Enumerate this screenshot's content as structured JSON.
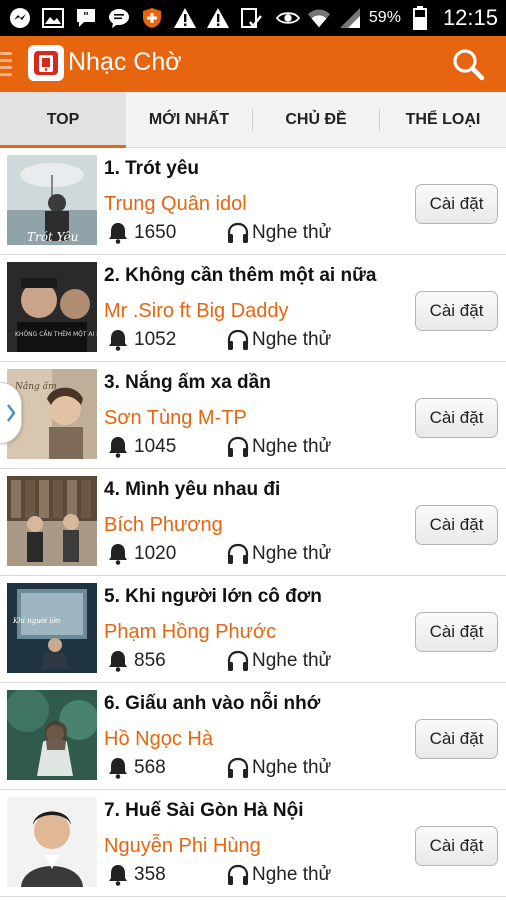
{
  "status_bar": {
    "battery": "59%",
    "time": "12:15"
  },
  "app_bar": {
    "title": "Nhạc Chờ"
  },
  "tabs": [
    {
      "label": "TOP",
      "active": true
    },
    {
      "label": "MỚI NHẤT",
      "active": false
    },
    {
      "label": "CHỦ ĐỀ",
      "active": false
    },
    {
      "label": "THỂ LOẠI",
      "active": false
    }
  ],
  "songs": [
    {
      "title": "1. Trót yêu",
      "artist": "Trung Quân idol",
      "count": "1650",
      "listen_label": "Nghe thử",
      "install_label": "Cài đặt"
    },
    {
      "title": "2. Không cần thêm một ai nữa",
      "artist": "Mr .Siro ft Big Daddy",
      "count": "1052",
      "listen_label": "Nghe thử",
      "install_label": "Cài đặt"
    },
    {
      "title": "3. Nắng ấm xa dần",
      "artist": "Sơn Tùng M-TP",
      "count": "1045",
      "listen_label": "Nghe thử",
      "install_label": "Cài đặt"
    },
    {
      "title": "4. Mình yêu nhau đi",
      "artist": "Bích Phương",
      "count": "1020",
      "listen_label": "Nghe thử",
      "install_label": "Cài đặt"
    },
    {
      "title": "5. Khi người lớn cô đơn",
      "artist": "Phạm Hồng Phước",
      "count": "856",
      "listen_label": "Nghe thử",
      "install_label": "Cài đặt"
    },
    {
      "title": "6. Giấu anh vào nỗi nhớ",
      "artist": "Hồ Ngọc Hà",
      "count": "568",
      "listen_label": "Nghe thử",
      "install_label": "Cài đặt"
    },
    {
      "title": "7. Huế Sài Gòn Hà Nội",
      "artist": "Nguyễn Phi Hùng",
      "count": "358",
      "listen_label": "Nghe thử",
      "install_label": "Cài đặt"
    }
  ],
  "colors": {
    "accent": "#e8650f",
    "status_bar": "#000000"
  },
  "icons": {
    "menu": "menu-handle-icon",
    "search": "search-icon",
    "ringtone_count": "bell-icon",
    "listen": "headphone-icon"
  }
}
